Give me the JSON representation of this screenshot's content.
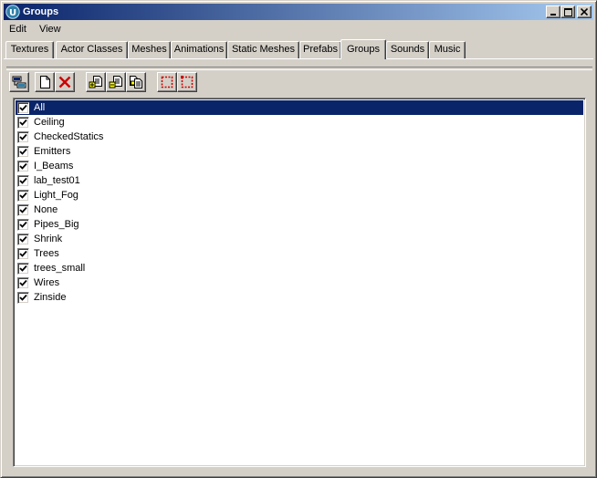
{
  "window": {
    "title": "Groups"
  },
  "menu": {
    "items": [
      "Edit",
      "View"
    ]
  },
  "tabs": [
    "Textures",
    "Actor Classes",
    "Meshes",
    "Animations",
    "Static Meshes",
    "Prefabs",
    "Groups",
    "Sounds",
    "Music"
  ],
  "active_tab": "Groups",
  "toolbar": {
    "icons": [
      "group-browser-icon",
      "new-group-icon",
      "delete-group-icon",
      "add-selected-to-group-icon",
      "remove-selected-from-group-icon",
      "rename-group-icon",
      "select-actors-icon",
      "deselect-actors-icon"
    ]
  },
  "groups": {
    "items": [
      {
        "label": "All",
        "checked": true,
        "selected": true
      },
      {
        "label": "Ceiling",
        "checked": true
      },
      {
        "label": "CheckedStatics",
        "checked": true
      },
      {
        "label": "Emitters",
        "checked": true
      },
      {
        "label": "I_Beams",
        "checked": true
      },
      {
        "label": "lab_test01",
        "checked": true
      },
      {
        "label": "Light_Fog",
        "checked": true
      },
      {
        "label": "None",
        "checked": true
      },
      {
        "label": "Pipes_Big",
        "checked": true
      },
      {
        "label": "Shrink",
        "checked": true
      },
      {
        "label": "Trees",
        "checked": true
      },
      {
        "label": "trees_small",
        "checked": true
      },
      {
        "label": "Wires",
        "checked": true
      },
      {
        "label": "Zinside",
        "checked": true
      }
    ]
  },
  "colors": {
    "selection": "#0a246a",
    "face": "#d4d0c8",
    "delete_red": "#cc0000"
  }
}
